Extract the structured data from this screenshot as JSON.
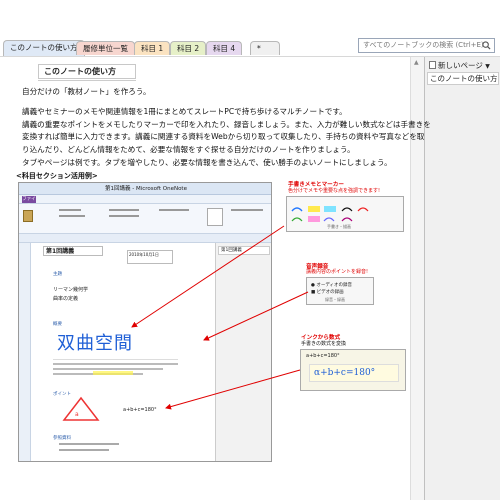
{
  "tabs": [
    {
      "label": "このノートの使い方",
      "color": "#dfe9f6"
    },
    {
      "label": "履修単位一覧",
      "color": "#f7d6cf"
    },
    {
      "label": "科目 1",
      "color": "#fbe3c1"
    },
    {
      "label": "科目 2",
      "color": "#e6f0c8"
    },
    {
      "label": "科目 4",
      "color": "#e6d8ef"
    }
  ],
  "search": {
    "placeholder": "すべてのノートブックの検索 (Ctrl+E)"
  },
  "sidebar": {
    "new_page": "新しいページ",
    "page_item": "このノートの使い方"
  },
  "page": {
    "title": "このノートの使い方",
    "lines": [
      "自分だけの「教材ノート」を作ろう。",
      "講義やセミナーのメモや関連情報を1冊にまとめてスレートPCで持ち歩けるマルチノートです。",
      "講義の重要なポイントをメモしたりマーカーで印を入れたり、録音しましょう。また、入力が難しい数式などは手書きを",
      "変換すれば簡単に入力できます。講義に関連する資料をWebから切り取って収集したり、手持ちの資料や写真などを取",
      "り込んだり、どんどん情報をためて、必要な情報をすぐ探せる自分だけのノートを作りましょう。",
      "タブやページは例です。タブを増やしたり、必要な情報を書き込んで、使い勝手のよいノートにしましょう。",
      "<科目セクション活用例>"
    ]
  },
  "screenshot": {
    "window_title": "第1回講義 - Microsoft OneNote",
    "page_name": "第1回講義",
    "date_text": "2010年10月1日",
    "sub_text": "リーマン幾何学",
    "sub_text2": "曲率の定義",
    "handwriting": "双曲空間",
    "formula": "a+b+c=180°",
    "section_main": "主題",
    "section_point": "ポイント",
    "section_ref": "参照資料"
  },
  "callouts": [
    {
      "title": "手書きメモとマーカー",
      "desc": "色分けでメモや重要な点を強調できます!",
      "color": "#e00000"
    },
    {
      "title": "音声録音",
      "desc": "講義内容のポイントを録音!",
      "color": "#e00000"
    },
    {
      "title": "インクから数式",
      "desc": "手書きの数式を変換",
      "color": "#e00000"
    }
  ],
  "ribbon": {
    "menu": "ファイル",
    "panel_title": "手書き・描画"
  },
  "audio_buttons": {
    "record_audio": "オーディオの録音",
    "record_video": "ビデオの録画",
    "group": "録音・録画"
  },
  "math_card": {
    "formula": "α+b+c=180°"
  }
}
